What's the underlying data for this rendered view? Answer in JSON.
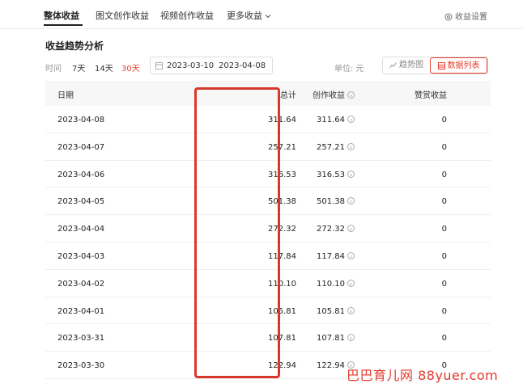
{
  "tabs": [
    {
      "label": "整体收益",
      "active": true
    },
    {
      "label": "图文创作收益",
      "active": false
    },
    {
      "label": "视频创作收益",
      "active": false
    },
    {
      "label": "更多收益",
      "active": false
    }
  ],
  "settings_label": "收益设置",
  "section_title": "收益趋势分析",
  "filter": {
    "time_label": "时间",
    "ranges": [
      "7天",
      "14天",
      "30天"
    ],
    "active_range": "30天",
    "date_start": "2023-03-10",
    "date_sep": "-",
    "date_end": "2023-04-08",
    "unit_label": "单位: 元",
    "view_trend": "趋势图",
    "view_table": "数据列表"
  },
  "table": {
    "headers": {
      "date": "日期",
      "total": "总计",
      "create": "创作收益",
      "reward": "赞赏收益"
    },
    "rows": [
      {
        "date": "2023-04-08",
        "total": "311.64",
        "create": "311.64",
        "reward": "0"
      },
      {
        "date": "2023-04-07",
        "total": "257.21",
        "create": "257.21",
        "reward": "0"
      },
      {
        "date": "2023-04-06",
        "total": "316.53",
        "create": "316.53",
        "reward": "0"
      },
      {
        "date": "2023-04-05",
        "total": "501.38",
        "create": "501.38",
        "reward": "0"
      },
      {
        "date": "2023-04-04",
        "total": "272.32",
        "create": "272.32",
        "reward": "0"
      },
      {
        "date": "2023-04-03",
        "total": "117.84",
        "create": "117.84",
        "reward": "0"
      },
      {
        "date": "2023-04-02",
        "total": "110.10",
        "create": "110.10",
        "reward": "0"
      },
      {
        "date": "2023-04-01",
        "total": "105.81",
        "create": "105.81",
        "reward": "0"
      },
      {
        "date": "2023-03-31",
        "total": "107.81",
        "create": "107.81",
        "reward": "0"
      },
      {
        "date": "2023-03-30",
        "total": "122.94",
        "create": "122.94",
        "reward": "0"
      }
    ]
  },
  "watermark": "巴巴育儿网 88yuer.com",
  "colors": {
    "accent": "#e8402f",
    "highlight_border": "#d8382c",
    "header_bg": "#f7f7f7"
  }
}
